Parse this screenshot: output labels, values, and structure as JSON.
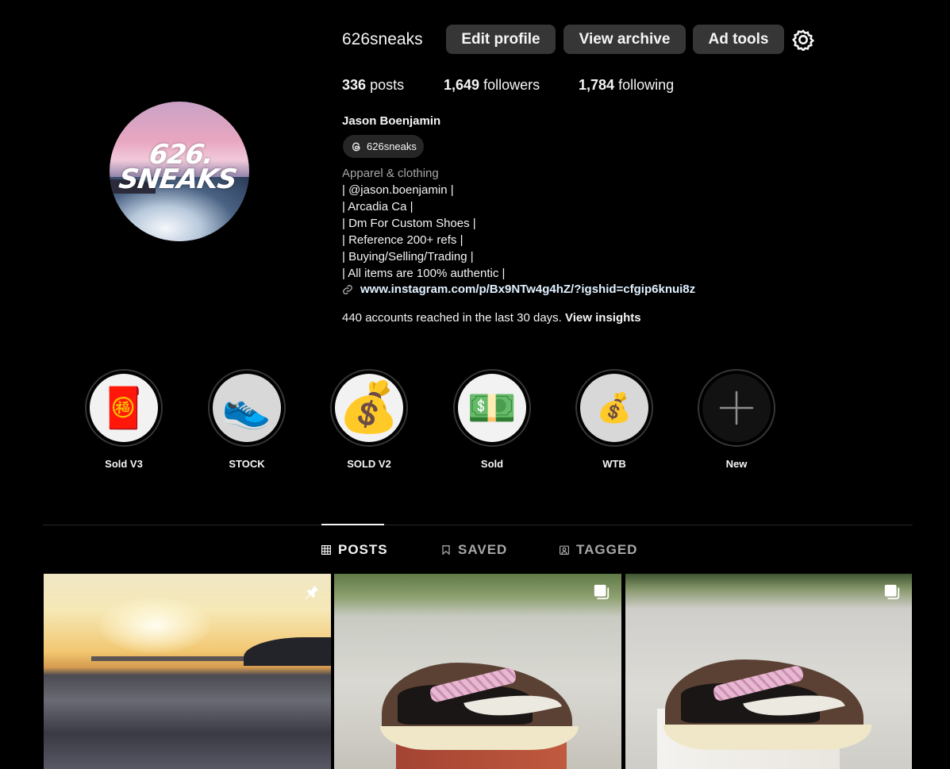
{
  "header": {
    "username": "626sneaks",
    "buttons": {
      "edit": "Edit profile",
      "archive": "View archive",
      "ad_tools": "Ad tools"
    }
  },
  "avatar": {
    "logo_line1": "626.",
    "logo_line2": "SNEAKS"
  },
  "stats": {
    "posts_count": "336",
    "posts_label": "posts",
    "followers_count": "1,649",
    "followers_label": "followers",
    "following_count": "1,784",
    "following_label": "following"
  },
  "profile": {
    "full_name": "Jason Boenjamin",
    "threads_handle": "626sneaks",
    "category": "Apparel & clothing",
    "bio_lines": [
      "| @jason.boenjamin |",
      "| Arcadia Ca |",
      "| Dm For Custom Shoes |",
      "| Reference 200+ refs |",
      "| Buying/Selling/Trading |",
      "| All items are 100% authentic |"
    ],
    "link": "www.instagram.com/p/Bx9NTw4g4hZ/?igshid=cfgip6knui8z",
    "reach_text": "440 accounts reached in the last 30 days.",
    "insights_label": "View insights"
  },
  "highlights": [
    {
      "label": "Sold V3",
      "icon": "red-envelope-icon",
      "glyph": "🧧"
    },
    {
      "label": "STOCK",
      "icon": "sneaker-icon",
      "glyph": "👟"
    },
    {
      "label": "SOLD V2",
      "icon": "money-bag-icon",
      "glyph": "💰"
    },
    {
      "label": "Sold",
      "icon": "dollar-banknote-icon",
      "glyph": "💵"
    },
    {
      "label": "WTB",
      "icon": "money-bag-icon",
      "glyph": "💰"
    },
    {
      "label": "New",
      "icon": "plus-icon",
      "glyph": "+"
    }
  ],
  "tabs": {
    "posts": "POSTS",
    "saved": "SAVED",
    "tagged": "TAGGED"
  },
  "posts": [
    {
      "icon": "pin-icon"
    },
    {
      "icon": "carousel-icon"
    },
    {
      "icon": "carousel-icon"
    }
  ],
  "colors": {
    "background": "#000000",
    "button": "#363636",
    "link": "#e0f1ff",
    "muted": "#a8a8a8"
  }
}
